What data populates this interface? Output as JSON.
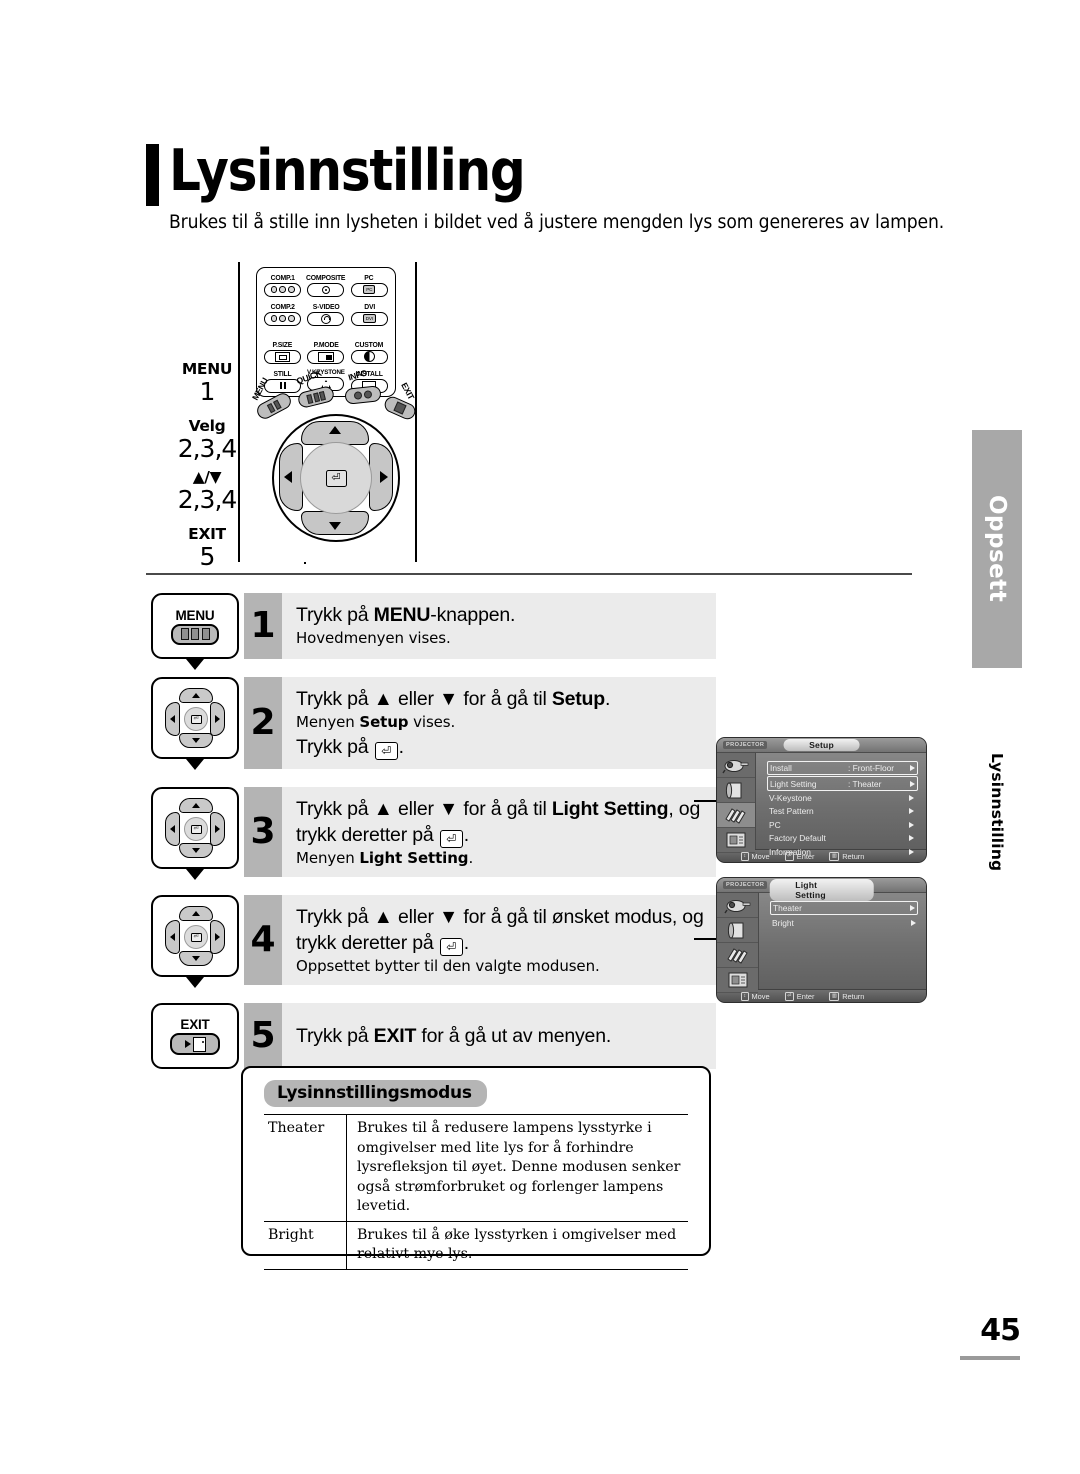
{
  "page": {
    "title": "Lysinnstilling",
    "subtitle": "Brukes til å stille inn lysheten i bildet ved å justere mengden lys som genereres av lampen.",
    "number": "45"
  },
  "side_tabs": {
    "chapter": "Oppsett",
    "section": "Lysinnstilling"
  },
  "remote": {
    "labels": [
      {
        "name": "MENU",
        "value": "1"
      },
      {
        "name": "Velg",
        "value": "2,3,4"
      },
      {
        "name": "▲/▼",
        "value": "2,3,4"
      },
      {
        "name": "EXIT",
        "value": "5"
      }
    ],
    "source_buttons": [
      {
        "label": "COMP.1",
        "icon": "three-dot-connector-icon"
      },
      {
        "label": "COMPOSITE",
        "icon": "rca-jack-icon"
      },
      {
        "label": "PC",
        "icon": "pc-label-icon"
      },
      {
        "label": "COMP.2",
        "icon": "three-dot-connector-icon"
      },
      {
        "label": "S-VIDEO",
        "icon": "s-video-jack-icon"
      },
      {
        "label": "DVI",
        "icon": "dvi-label-icon"
      }
    ],
    "function_buttons": [
      {
        "label": "P.SIZE",
        "icon": "picture-size-icon"
      },
      {
        "label": "P.MODE",
        "icon": "picture-mode-icon"
      },
      {
        "label": "CUSTOM",
        "icon": "contrast-half-circle-icon"
      },
      {
        "label": "STILL",
        "icon": "pause-icon"
      },
      {
        "label": "V.KEYSTONE",
        "icon": "keystone-trapezoid-icon"
      },
      {
        "label": "INSTALL",
        "icon": "install-screen-icon"
      }
    ],
    "wheel_keys": [
      {
        "label": "MENU",
        "icon": "menu-key-icon"
      },
      {
        "label": "QUICK",
        "icon": "quick-key-icon"
      },
      {
        "label": "INFO",
        "icon": "info-key-icon"
      },
      {
        "label": "EXIT",
        "icon": "exit-key-icon"
      }
    ]
  },
  "steps": [
    {
      "number": "1",
      "icon": "menu-button-icon",
      "icon_caption": "MENU",
      "main_pre": "Trykk på ",
      "main_bold": "MENU",
      "main_post": "-knappen.",
      "sub": "Hovedmenyen vises."
    },
    {
      "number": "2",
      "icon": "navigation-pad-icon",
      "main_pre": "Trykk på ▲ eller ▼ for å gå til ",
      "main_bold": "Setup",
      "main_post": ".",
      "sub_pre": "Menyen ",
      "sub_bold": "Setup",
      "sub_post": " vises.",
      "extra_pre": "Trykk på ",
      "extra_post": "."
    },
    {
      "number": "3",
      "icon": "navigation-pad-icon",
      "main_pre": "Trykk på ▲ eller ▼ for å gå til ",
      "main_bold": "Light Setting",
      "main_post": ", og",
      "main_line2_pre": "trykk deretter på ",
      "main_line2_post": ".",
      "sub_pre": "Menyen ",
      "sub_bold": "Light Setting",
      "sub_post": "."
    },
    {
      "number": "4",
      "icon": "navigation-pad-icon",
      "main_pre": "Trykk på ▲ eller ▼ for å gå til ønsket modus, og",
      "main_line2_pre": "trykk deretter på ",
      "main_line2_post": ".",
      "sub": "Oppsettet bytter til den valgte modusen."
    },
    {
      "number": "5",
      "icon": "exit-button-icon",
      "icon_caption": "EXIT",
      "main_pre": "Trykk på ",
      "main_bold": "EXIT",
      "main_post": " for å gå ut av menyen."
    }
  ],
  "osd_setup": {
    "brand": "PROJECTOR",
    "title": "Setup",
    "rows": [
      {
        "label": "Install",
        "value": ": Front-Floor",
        "selected": false
      },
      {
        "label": "Light Setting",
        "value": ": Theater",
        "selected": true
      },
      {
        "label": "V-Keystone",
        "value": "",
        "selected": false
      },
      {
        "label": "Test Pattern",
        "value": "",
        "selected": false
      },
      {
        "label": "PC",
        "value": "",
        "selected": false
      },
      {
        "label": "Factory Default",
        "value": "",
        "selected": false
      },
      {
        "label": "Information",
        "value": "",
        "selected": false
      }
    ],
    "footer": [
      {
        "key": "↕",
        "label": "Move"
      },
      {
        "key": "⏎",
        "label": "Enter"
      },
      {
        "key": "▥",
        "label": "Return"
      }
    ]
  },
  "osd_light": {
    "brand": "PROJECTOR",
    "title": "Light Setting",
    "rows": [
      {
        "label": "Theater",
        "value": "",
        "selected": true
      },
      {
        "label": "Bright",
        "value": "",
        "selected": false
      }
    ],
    "footer": [
      {
        "key": "↕",
        "label": "Move"
      },
      {
        "key": "⏎",
        "label": "Enter"
      },
      {
        "key": "▥",
        "label": "Return"
      }
    ]
  },
  "mode_table": {
    "badge": "Lysinnstillingsmodus",
    "rows": [
      {
        "name": "Theater",
        "desc": "Brukes til å redusere lampens lysstyrke i omgivelser med lite lys for å forhindre lysrefleksjon til øyet. Denne modusen senker også strømforbruket og forlenger lampens levetid."
      },
      {
        "name": "Bright",
        "desc": "Brukes til å øke lysstyrken i omgivelser med relativt mye lys."
      }
    ]
  },
  "colors": {
    "step_number_bg": "#b4b4b4",
    "step_body_bg": "#ebebeb",
    "tab_bg": "#a8a8a8",
    "badge_bg": "#b5b5b5"
  }
}
